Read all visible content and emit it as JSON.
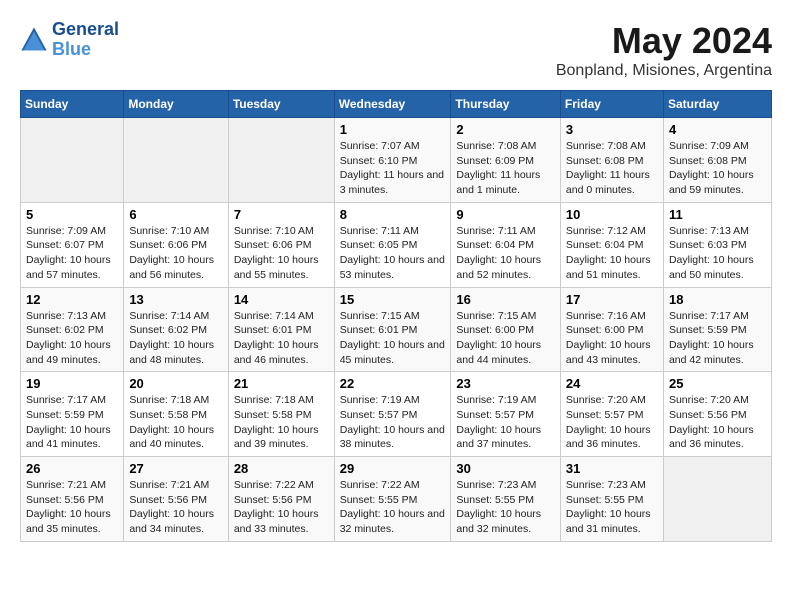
{
  "header": {
    "logo_line1": "General",
    "logo_line2": "Blue",
    "month": "May 2024",
    "location": "Bonpland, Misiones, Argentina"
  },
  "weekdays": [
    "Sunday",
    "Monday",
    "Tuesday",
    "Wednesday",
    "Thursday",
    "Friday",
    "Saturday"
  ],
  "weeks": [
    [
      {
        "day": "",
        "empty": true
      },
      {
        "day": "",
        "empty": true
      },
      {
        "day": "",
        "empty": true
      },
      {
        "day": "1",
        "sunrise": "Sunrise: 7:07 AM",
        "sunset": "Sunset: 6:10 PM",
        "daylight": "Daylight: 11 hours and 3 minutes."
      },
      {
        "day": "2",
        "sunrise": "Sunrise: 7:08 AM",
        "sunset": "Sunset: 6:09 PM",
        "daylight": "Daylight: 11 hours and 1 minute."
      },
      {
        "day": "3",
        "sunrise": "Sunrise: 7:08 AM",
        "sunset": "Sunset: 6:08 PM",
        "daylight": "Daylight: 11 hours and 0 minutes."
      },
      {
        "day": "4",
        "sunrise": "Sunrise: 7:09 AM",
        "sunset": "Sunset: 6:08 PM",
        "daylight": "Daylight: 10 hours and 59 minutes."
      }
    ],
    [
      {
        "day": "5",
        "sunrise": "Sunrise: 7:09 AM",
        "sunset": "Sunset: 6:07 PM",
        "daylight": "Daylight: 10 hours and 57 minutes."
      },
      {
        "day": "6",
        "sunrise": "Sunrise: 7:10 AM",
        "sunset": "Sunset: 6:06 PM",
        "daylight": "Daylight: 10 hours and 56 minutes."
      },
      {
        "day": "7",
        "sunrise": "Sunrise: 7:10 AM",
        "sunset": "Sunset: 6:06 PM",
        "daylight": "Daylight: 10 hours and 55 minutes."
      },
      {
        "day": "8",
        "sunrise": "Sunrise: 7:11 AM",
        "sunset": "Sunset: 6:05 PM",
        "daylight": "Daylight: 10 hours and 53 minutes."
      },
      {
        "day": "9",
        "sunrise": "Sunrise: 7:11 AM",
        "sunset": "Sunset: 6:04 PM",
        "daylight": "Daylight: 10 hours and 52 minutes."
      },
      {
        "day": "10",
        "sunrise": "Sunrise: 7:12 AM",
        "sunset": "Sunset: 6:04 PM",
        "daylight": "Daylight: 10 hours and 51 minutes."
      },
      {
        "day": "11",
        "sunrise": "Sunrise: 7:13 AM",
        "sunset": "Sunset: 6:03 PM",
        "daylight": "Daylight: 10 hours and 50 minutes."
      }
    ],
    [
      {
        "day": "12",
        "sunrise": "Sunrise: 7:13 AM",
        "sunset": "Sunset: 6:02 PM",
        "daylight": "Daylight: 10 hours and 49 minutes."
      },
      {
        "day": "13",
        "sunrise": "Sunrise: 7:14 AM",
        "sunset": "Sunset: 6:02 PM",
        "daylight": "Daylight: 10 hours and 48 minutes."
      },
      {
        "day": "14",
        "sunrise": "Sunrise: 7:14 AM",
        "sunset": "Sunset: 6:01 PM",
        "daylight": "Daylight: 10 hours and 46 minutes."
      },
      {
        "day": "15",
        "sunrise": "Sunrise: 7:15 AM",
        "sunset": "Sunset: 6:01 PM",
        "daylight": "Daylight: 10 hours and 45 minutes."
      },
      {
        "day": "16",
        "sunrise": "Sunrise: 7:15 AM",
        "sunset": "Sunset: 6:00 PM",
        "daylight": "Daylight: 10 hours and 44 minutes."
      },
      {
        "day": "17",
        "sunrise": "Sunrise: 7:16 AM",
        "sunset": "Sunset: 6:00 PM",
        "daylight": "Daylight: 10 hours and 43 minutes."
      },
      {
        "day": "18",
        "sunrise": "Sunrise: 7:17 AM",
        "sunset": "Sunset: 5:59 PM",
        "daylight": "Daylight: 10 hours and 42 minutes."
      }
    ],
    [
      {
        "day": "19",
        "sunrise": "Sunrise: 7:17 AM",
        "sunset": "Sunset: 5:59 PM",
        "daylight": "Daylight: 10 hours and 41 minutes."
      },
      {
        "day": "20",
        "sunrise": "Sunrise: 7:18 AM",
        "sunset": "Sunset: 5:58 PM",
        "daylight": "Daylight: 10 hours and 40 minutes."
      },
      {
        "day": "21",
        "sunrise": "Sunrise: 7:18 AM",
        "sunset": "Sunset: 5:58 PM",
        "daylight": "Daylight: 10 hours and 39 minutes."
      },
      {
        "day": "22",
        "sunrise": "Sunrise: 7:19 AM",
        "sunset": "Sunset: 5:57 PM",
        "daylight": "Daylight: 10 hours and 38 minutes."
      },
      {
        "day": "23",
        "sunrise": "Sunrise: 7:19 AM",
        "sunset": "Sunset: 5:57 PM",
        "daylight": "Daylight: 10 hours and 37 minutes."
      },
      {
        "day": "24",
        "sunrise": "Sunrise: 7:20 AM",
        "sunset": "Sunset: 5:57 PM",
        "daylight": "Daylight: 10 hours and 36 minutes."
      },
      {
        "day": "25",
        "sunrise": "Sunrise: 7:20 AM",
        "sunset": "Sunset: 5:56 PM",
        "daylight": "Daylight: 10 hours and 36 minutes."
      }
    ],
    [
      {
        "day": "26",
        "sunrise": "Sunrise: 7:21 AM",
        "sunset": "Sunset: 5:56 PM",
        "daylight": "Daylight: 10 hours and 35 minutes."
      },
      {
        "day": "27",
        "sunrise": "Sunrise: 7:21 AM",
        "sunset": "Sunset: 5:56 PM",
        "daylight": "Daylight: 10 hours and 34 minutes."
      },
      {
        "day": "28",
        "sunrise": "Sunrise: 7:22 AM",
        "sunset": "Sunset: 5:56 PM",
        "daylight": "Daylight: 10 hours and 33 minutes."
      },
      {
        "day": "29",
        "sunrise": "Sunrise: 7:22 AM",
        "sunset": "Sunset: 5:55 PM",
        "daylight": "Daylight: 10 hours and 32 minutes."
      },
      {
        "day": "30",
        "sunrise": "Sunrise: 7:23 AM",
        "sunset": "Sunset: 5:55 PM",
        "daylight": "Daylight: 10 hours and 32 minutes."
      },
      {
        "day": "31",
        "sunrise": "Sunrise: 7:23 AM",
        "sunset": "Sunset: 5:55 PM",
        "daylight": "Daylight: 10 hours and 31 minutes."
      },
      {
        "day": "",
        "empty": true
      }
    ]
  ]
}
